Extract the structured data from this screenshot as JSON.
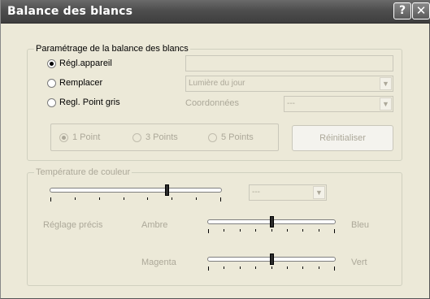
{
  "window": {
    "title": "Balance des blancs",
    "help_label": "?",
    "close_label": "✕"
  },
  "wb_group": {
    "legend": "Paramétrage de la balance des blancs",
    "options": [
      {
        "label": "Régl.appareil",
        "checked": true
      },
      {
        "label": "Remplacer",
        "checked": false
      },
      {
        "label": "Regl. Point gris",
        "checked": false
      }
    ],
    "preset_select": {
      "value": "Lumière du jour",
      "enabled": false
    },
    "coords_label": "Coordonnées",
    "coords_select": {
      "value": "---",
      "enabled": false
    },
    "points": [
      {
        "label": "1 Point",
        "checked": true
      },
      {
        "label": "3 Points",
        "checked": false
      },
      {
        "label": "5 Points",
        "checked": false
      }
    ],
    "reset_button": "Réinitialiser"
  },
  "temp_group": {
    "legend": "Température de couleur",
    "temp_slider_level": 0.68,
    "temp_select": {
      "value": "---",
      "enabled": false
    },
    "fine_label": "Réglage précis",
    "amber_label": "Ambre",
    "blue_label": "Bleu",
    "amber_blue_level": 0.5,
    "magenta_label": "Magenta",
    "green_label": "Vert",
    "magenta_green_level": 0.5
  }
}
